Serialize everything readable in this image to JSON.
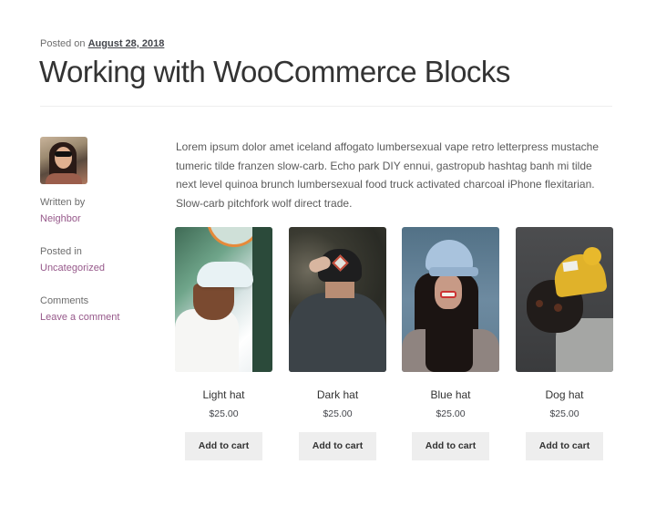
{
  "post": {
    "posted_on_label": "Posted on",
    "date": "August 28, 2018",
    "title": "Working with WooCommerce Blocks"
  },
  "sidebar": {
    "avatar_alt": "Author avatar",
    "written_by_label": "Written by",
    "author": "Neighbor",
    "posted_in_label": "Posted in",
    "category": "Uncategorized",
    "comments_label": "Comments",
    "comments_link": "Leave a comment"
  },
  "content": {
    "paragraph": "Lorem ipsum dolor amet iceland affogato lumbersexual vape retro letterpress mustache tumeric tilde franzen slow-carb. Echo park DIY ennui, gastropub hashtag banh mi tilde next level quinoa brunch lumbersexual food truck activated charcoal iPhone flexitarian. Slow-carb pitchfork wolf direct trade."
  },
  "products": [
    {
      "name": "Light hat",
      "price": "$25.00",
      "button": "Add to cart"
    },
    {
      "name": "Dark hat",
      "price": "$25.00",
      "button": "Add to cart"
    },
    {
      "name": "Blue hat",
      "price": "$25.00",
      "button": "Add to cart"
    },
    {
      "name": "Dog hat",
      "price": "$25.00",
      "button": "Add to cart"
    }
  ],
  "colors": {
    "link": "#96588a",
    "button_bg": "#eeeeee",
    "text": "#43454b"
  }
}
